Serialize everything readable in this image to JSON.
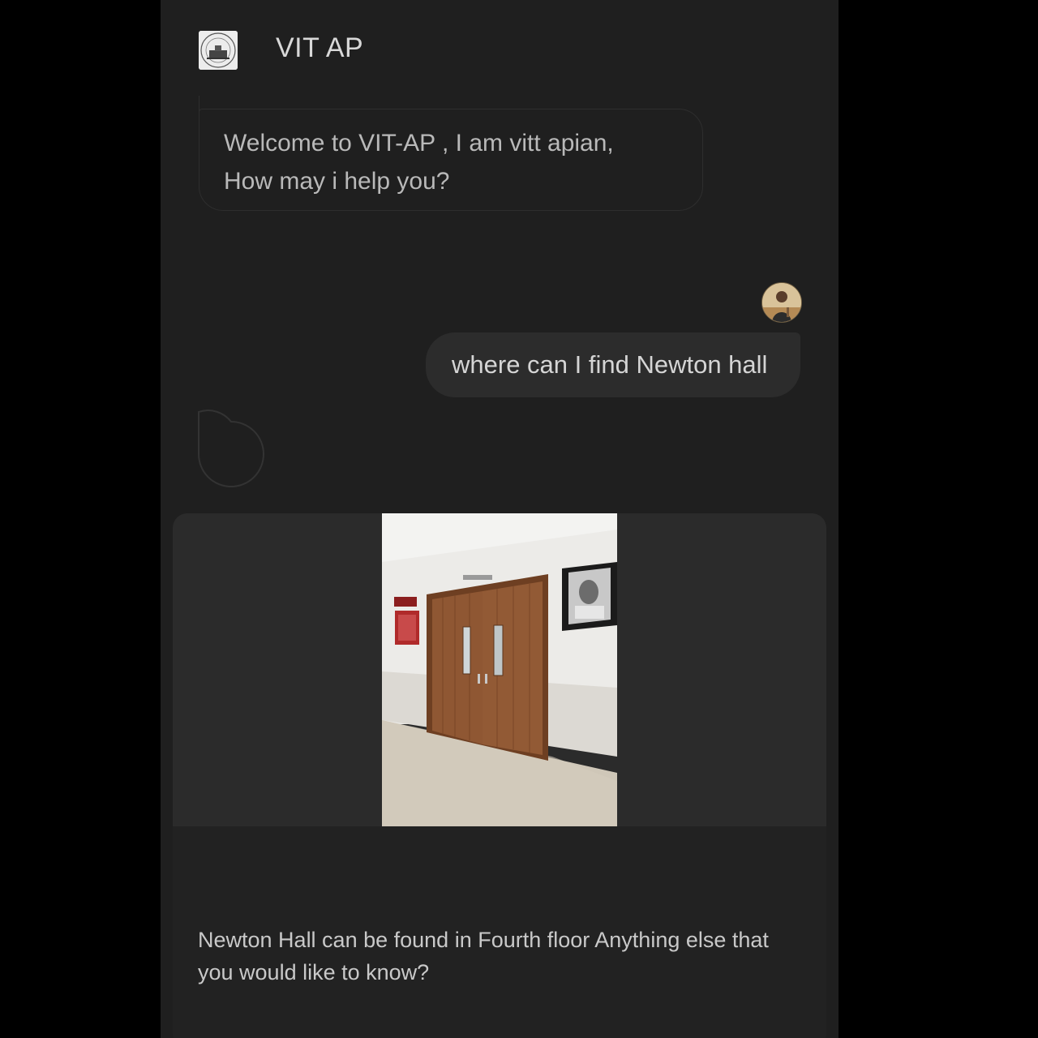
{
  "header": {
    "title": "VIT AP",
    "logo_icon": "vit-crest-logo"
  },
  "messages": [
    {
      "sender": "bot",
      "lines": [
        "Welcome to VIT-AP , I am vitt apian,",
        "How may i help you?"
      ]
    },
    {
      "sender": "user",
      "text": "where can I find Newton hall",
      "avatar_icon": "user-avatar"
    },
    {
      "sender": "bot",
      "typing_icon": "bot-response-indicator-icon"
    },
    {
      "sender": "bot",
      "type": "card",
      "image": "newton-hall-door-photo",
      "text": "Newton Hall can be found in Fourth floor Anything else that you would like to know?"
    }
  ],
  "colors": {
    "page_background": "#000000",
    "app_background": "#1f1f1f",
    "user_bubble": "#2c2c2c",
    "card_media_background": "#2b2b2b",
    "door_wood": "#8a5530"
  }
}
